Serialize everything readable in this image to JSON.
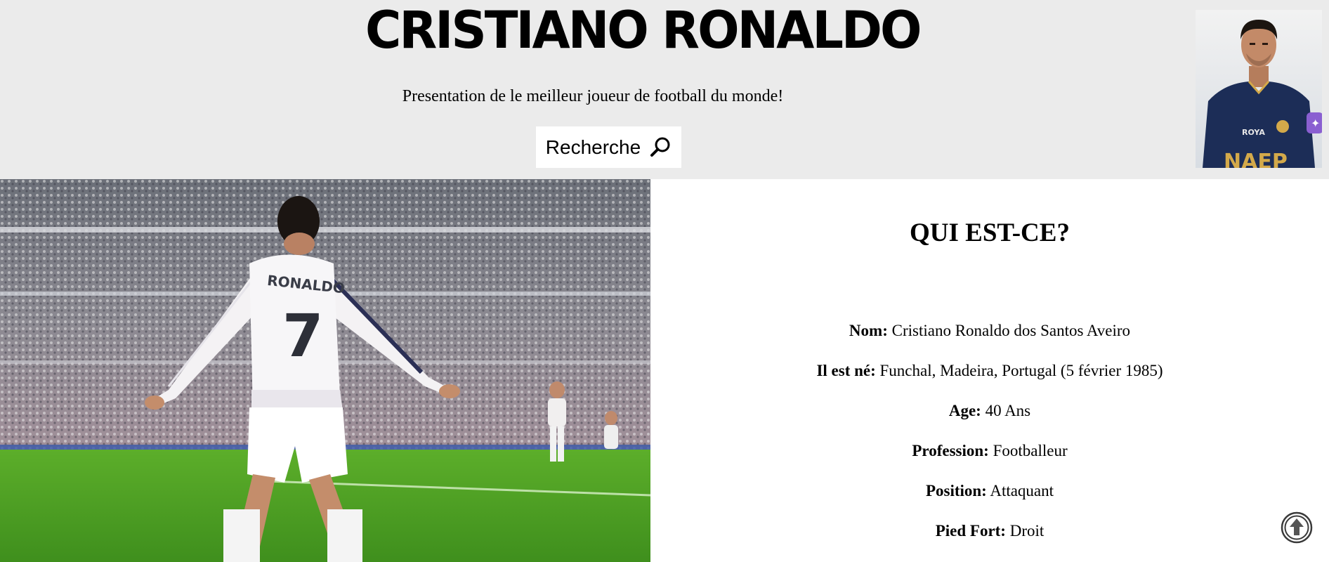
{
  "header": {
    "title": "CRISTIANO RONALDO",
    "tagline": "Presentation de le meilleur joueur de football du monde!",
    "search_label": "Recherche",
    "search_icon": "search-icon"
  },
  "avatar": {
    "jersey_text": "ROYA",
    "jersey_bottom_text": "NAEP"
  },
  "hero": {
    "jersey_name": "RONALDO",
    "jersey_number": "7"
  },
  "info": {
    "heading": "QUI EST-CE?",
    "rows": [
      {
        "label": "Nom:",
        "value": "Cristiano Ronaldo dos Santos Aveiro"
      },
      {
        "label": "Il est né:",
        "value": "Funchal, Madeira, Portugal (5 février 1985)"
      },
      {
        "label": "Age:",
        "value": "40 Ans"
      },
      {
        "label": "Profession:",
        "value": "Footballeur"
      },
      {
        "label": "Position:",
        "value": "Attaquant"
      },
      {
        "label": "Pied Fort:",
        "value": "Droit"
      }
    ]
  },
  "scroll_top_icon": "arrow-up-circle-icon",
  "colors": {
    "header_bg": "#ebebeb",
    "page_bg": "#ffffff",
    "text": "#000000"
  }
}
